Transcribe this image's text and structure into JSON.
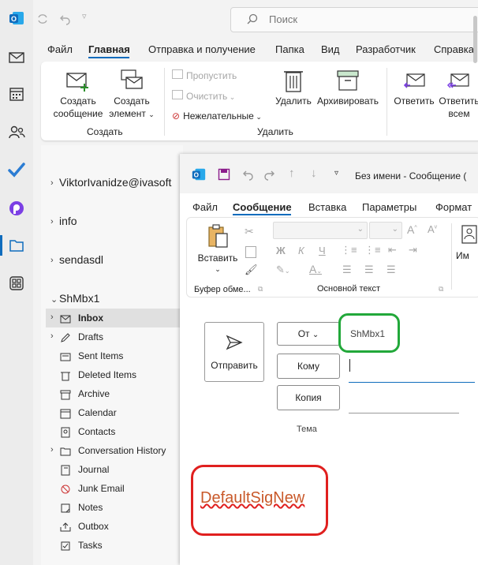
{
  "search": {
    "placeholder": "Поиск"
  },
  "main_tabs": [
    "Файл",
    "Главная",
    "Отправка и получение",
    "Папка",
    "Вид",
    "Разработчик",
    "Справка"
  ],
  "ribbon": {
    "new_message": [
      "Создать",
      "сообщение"
    ],
    "new_item": [
      "Создать",
      "элемент"
    ],
    "ignore": "Пропустить",
    "clean": "Очистить",
    "junk": "Нежелательные",
    "delete": "Удалить",
    "archive": "Архивировать",
    "reply": "Ответить",
    "reply_all": [
      "Ответить",
      "всем"
    ],
    "group_create": "Создать",
    "group_delete": "Удалить"
  },
  "accounts": [
    "ViktorIvanidze@ivasoft",
    "info",
    "sendasdl",
    "ShMbx1"
  ],
  "folders": [
    {
      "name": "Inbox",
      "icon": "inbox-icon",
      "expand": true,
      "selected": true
    },
    {
      "name": "Drafts",
      "icon": "drafts-icon",
      "expand": true
    },
    {
      "name": "Sent Items",
      "icon": "sent-icon"
    },
    {
      "name": "Deleted Items",
      "icon": "trash-icon"
    },
    {
      "name": "Archive",
      "icon": "archive-icon"
    },
    {
      "name": "Calendar",
      "icon": "calendar-icon"
    },
    {
      "name": "Contacts",
      "icon": "contacts-icon"
    },
    {
      "name": "Conversation History",
      "icon": "folder-icon",
      "expand": true
    },
    {
      "name": "Journal",
      "icon": "journal-icon"
    },
    {
      "name": "Junk Email",
      "icon": "junk-icon"
    },
    {
      "name": "Notes",
      "icon": "notes-icon"
    },
    {
      "name": "Outbox",
      "icon": "outbox-icon"
    },
    {
      "name": "Tasks",
      "icon": "tasks-icon"
    }
  ],
  "compose": {
    "title": "Без имени  -  Сообщение (",
    "tabs": [
      "Файл",
      "Сообщение",
      "Вставка",
      "Параметры",
      "Формат"
    ],
    "paste": "Вставить",
    "clipboard_group": "Буфер обме...",
    "basic_text_group": "Основной текст",
    "im_label": "Им",
    "send": "Отправить",
    "from_btn": "От",
    "from_value": "ShMbx1",
    "to_btn": "Кому",
    "cc_btn": "Копия",
    "subject_label": "Тема",
    "signature": "DefaultSigNew"
  },
  "colors": {
    "accent": "#0f6cbd",
    "highlight_green": "#22a83a",
    "highlight_red": "#e0201f",
    "signature": "#c9592a"
  }
}
